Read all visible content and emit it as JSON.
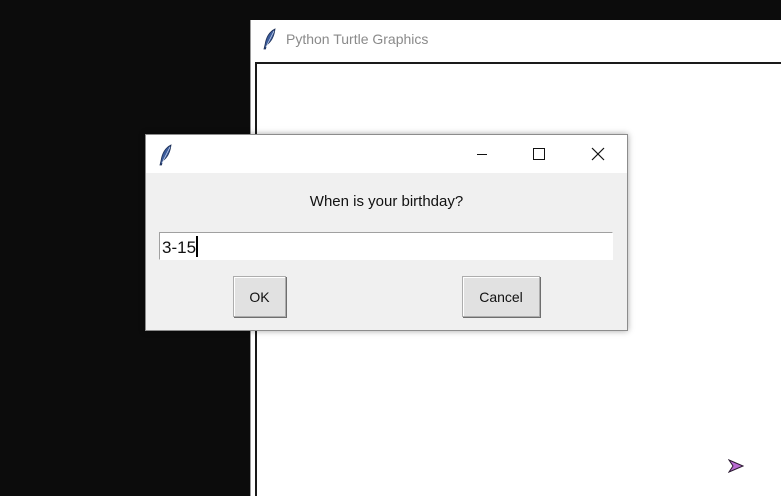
{
  "turtle_window": {
    "title": "Python Turtle Graphics"
  },
  "dialog": {
    "prompt": "When is your birthday?",
    "entry_value": "3-15",
    "ok_label": "OK",
    "cancel_label": "Cancel",
    "controls": [
      "minimize-icon",
      "maximize-icon",
      "close-icon"
    ]
  },
  "colors": {
    "desktop": "#0c0c0c",
    "dialog_bg": "#f0f0f0",
    "turtle_cursor": "#b86ad0"
  }
}
